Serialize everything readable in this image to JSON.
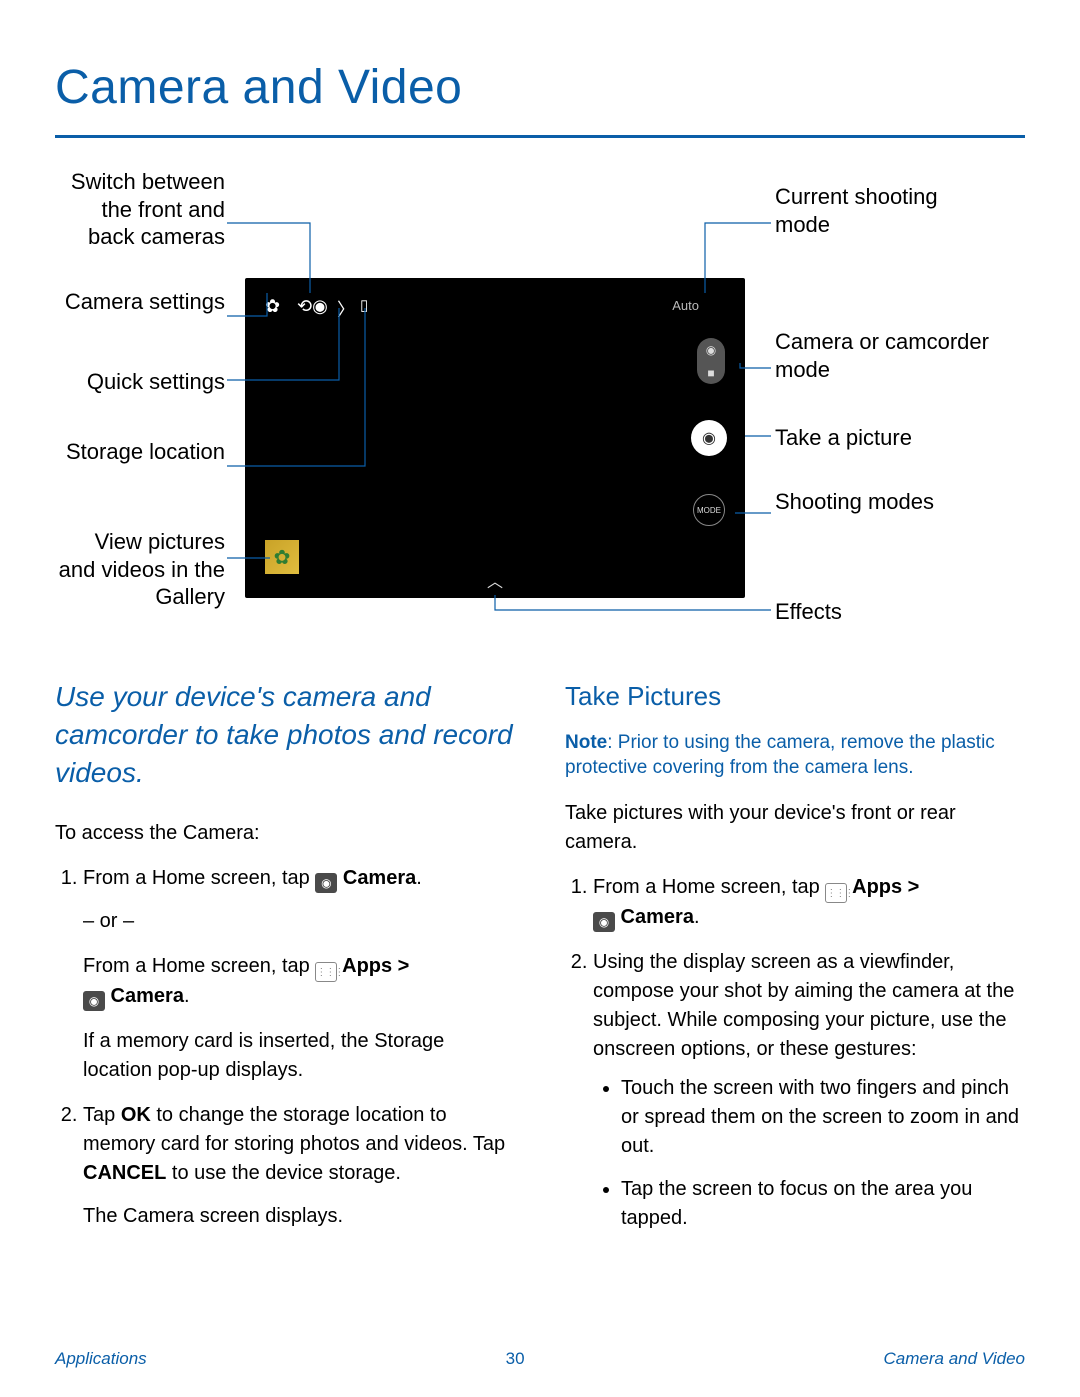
{
  "page_title": "Camera and Video",
  "callouts": {
    "switch_cam": "Switch between the front and back cameras",
    "cam_settings": "Camera settings",
    "quick_settings": "Quick settings",
    "storage": "Storage location",
    "gallery": "View pictures and videos in the Gallery",
    "shoot_mode": "Current shooting mode",
    "cam_camcorder": "Camera or camcorder mode",
    "take_pic": "Take a picture",
    "shooting_modes": "Shooting modes",
    "effects": "Effects"
  },
  "phone": {
    "auto_label": "Auto",
    "mode_label": "MODE"
  },
  "intro": "Use your device's camera and camcorder to take photos and record videos.",
  "access_label": "To access the Camera:",
  "step1a_pre": "From a Home screen, tap ",
  "step1a_post": " Camera",
  "or_text": "– or –",
  "step1b_pre": "From a Home screen, tap ",
  "step1b_mid": " Apps > ",
  "step1b_post": " Camera",
  "step1c": "If a memory card is inserted, the Storage location pop-up displays.",
  "step2": "Tap OK to change the storage location to memory card for storing photos and videos. Tap CANCEL to use the device storage.",
  "step2b": "The Camera screen displays.",
  "take_heading": "Take Pictures",
  "note_pre": "Note",
  "note_body": ": Prior to using the camera, remove the plastic protective covering from the camera lens.",
  "take_intro": "Take pictures with your device's front or rear camera.",
  "tstep1_pre": "From a Home screen, tap ",
  "tstep1_mid": " Apps > ",
  "tstep1_post": " Camera",
  "tstep2": "Using the display screen as a viewfinder, compose your shot by aiming the camera at the subject. While composing your picture, use the onscreen options, or these gestures:",
  "bullet1": "Touch the screen with two fingers and pinch or spread them on the screen to zoom in and out.",
  "bullet2": "Tap the screen to focus on the area you tapped.",
  "footer": {
    "left": "Applications",
    "page": "30",
    "right": "Camera and Video"
  }
}
